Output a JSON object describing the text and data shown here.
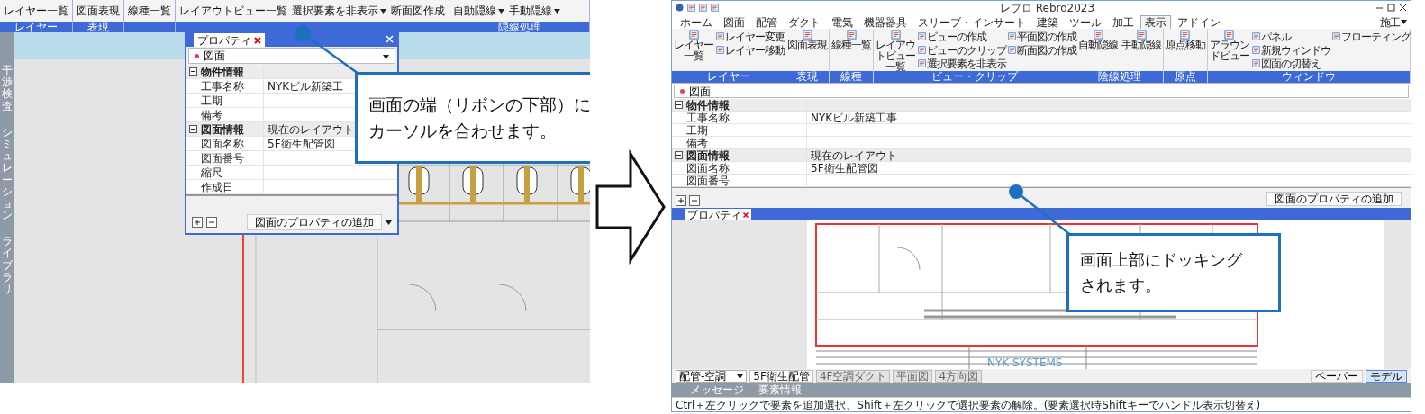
{
  "left_screenshot": {
    "ribbon": [
      {
        "label": "レイヤー",
        "buttons": [
          {
            "label": "レイヤー一覧",
            "menu": false
          }
        ]
      },
      {
        "label": "表現",
        "buttons": [
          {
            "label": "図面表現",
            "menu": false
          }
        ]
      },
      {
        "buttons": [
          {
            "label": "線種一覧",
            "menu": false
          }
        ]
      },
      {
        "buttons": [
          {
            "label": "レイアウトビュー一覧",
            "menu": false
          },
          {
            "label": "選択要素を非表示",
            "menu": true
          },
          {
            "label": "断面図作成",
            "menu": false
          }
        ]
      },
      {
        "label": "隠線処理",
        "buttons": [
          {
            "label": "自動隠線",
            "menu": true
          },
          {
            "label": "手動隠線",
            "menu": true
          }
        ]
      }
    ],
    "side_tabs": [
      "干渉検査",
      "シミュレーション",
      "ライブラリ"
    ],
    "property_window": {
      "tab": "プロパティ",
      "selector": "図面",
      "sections": [
        {
          "title": "物件情報",
          "expanded": true,
          "rows": [
            {
              "name": "工事名称",
              "value": "NYKビル新築工"
            },
            {
              "name": "工期"
            },
            {
              "name": "備考"
            }
          ]
        },
        {
          "title": "図面情報",
          "value": "現在のレイアウト",
          "expanded": true,
          "rows": [
            {
              "name": "図面名称",
              "value": "5F衛生配管図"
            },
            {
              "name": "図面番号"
            },
            {
              "name": "縮尺"
            },
            {
              "name": "作成日"
            }
          ]
        }
      ],
      "add_button": "図面のプロパティの追加"
    },
    "callout": [
      "画面の端（リボンの下部）に",
      "カーソルを合わせます。"
    ]
  },
  "right_screenshot": {
    "title": "レブロ Rebro2023",
    "menu_tabs": [
      {
        "label": "ホーム",
        "selected": false
      },
      {
        "label": "図面",
        "selected": false
      },
      {
        "label": "配管",
        "selected": false
      },
      {
        "label": "ダクト",
        "selected": false
      },
      {
        "label": "電気",
        "selected": false
      },
      {
        "label": "機器器具",
        "selected": false
      },
      {
        "label": "スリーブ・インサート",
        "selected": false
      },
      {
        "label": "建築",
        "selected": false
      },
      {
        "label": "ツール",
        "selected": false
      },
      {
        "label": "加工",
        "selected": false
      },
      {
        "label": "表示",
        "selected": true
      },
      {
        "label": "アドイン",
        "selected": false
      }
    ],
    "mode_selector": "施工",
    "ribbon": [
      {
        "label": "レイヤー",
        "buttons": [
          {
            "label": "レイヤー一覧",
            "kind": "large"
          },
          {
            "label": "レイヤー変更",
            "kind": "small"
          },
          {
            "label": "レイヤー移動",
            "kind": "small"
          }
        ]
      },
      {
        "label": "表現",
        "buttons": [
          {
            "label": "図面表現",
            "kind": "large"
          }
        ]
      },
      {
        "label": "線種",
        "buttons": [
          {
            "label": "線種一覧",
            "kind": "large"
          }
        ]
      },
      {
        "label": "ビュー・クリップ",
        "buttons": [
          {
            "label": "レイアウトビュー一覧",
            "kind": "large"
          },
          {
            "label": "ビューの作成",
            "kind": "small"
          },
          {
            "label": "ビューのクリップ",
            "kind": "small"
          },
          {
            "label": "選択要素を非表示",
            "kind": "small"
          },
          {
            "label": "平面図の作成",
            "kind": "small"
          },
          {
            "label": "断面図の作成",
            "kind": "small"
          }
        ]
      },
      {
        "label": "陰線処理",
        "buttons": [
          {
            "label": "自動隠線",
            "kind": "large"
          },
          {
            "label": "手動隠線",
            "kind": "large"
          }
        ]
      },
      {
        "label": "原点",
        "buttons": [
          {
            "label": "原点移動",
            "kind": "large"
          }
        ]
      },
      {
        "label": "ウィンドウ",
        "buttons": [
          {
            "label": "アラウンドビュー",
            "kind": "large"
          },
          {
            "label": "パネル",
            "kind": "small"
          },
          {
            "label": "新規ウィンドウ",
            "kind": "small"
          },
          {
            "label": "図面の切替え",
            "kind": "small"
          },
          {
            "label": "フローティング",
            "kind": "small"
          }
        ]
      }
    ],
    "properties": {
      "selector": "図面",
      "sections": [
        {
          "title": "物件情報",
          "expanded": true,
          "rows": [
            {
              "name": "工事名称",
              "value": "NYKビル新築工事"
            },
            {
              "name": "工期"
            },
            {
              "name": "備考"
            }
          ]
        },
        {
          "title": "図面情報",
          "value": "現在のレイアウト",
          "expanded": true,
          "rows": [
            {
              "name": "図面名称",
              "value": "5F衛生配管図"
            },
            {
              "name": "図面番号"
            }
          ]
        }
      ],
      "add_button": "図面のプロパティの追加",
      "tab": "プロパティ"
    },
    "drawing_logo": "NYK SYSTEMS",
    "callout": [
      "画面上部にドッキング",
      "されます。"
    ],
    "layer_selector": "配管-空調",
    "sheet_tabs": [
      {
        "label": "5F衛生配管",
        "selected": true
      },
      {
        "label": "4F空調ダクト",
        "selected": false
      },
      {
        "label": "平面図",
        "selected": false
      },
      {
        "label": "4方向図",
        "selected": false
      }
    ],
    "panel_tabs": [
      "メッセージ",
      "要素情報"
    ],
    "status_message": "Ctrl＋左クリックで要素を追加選択、Shift＋左クリックで選択要素の解除。(要素選択時Shiftキーでハンドル表示切替え)",
    "space_buttons": [
      {
        "label": "ペーパー",
        "selected": false
      },
      {
        "label": "モデル",
        "selected": true
      }
    ]
  }
}
